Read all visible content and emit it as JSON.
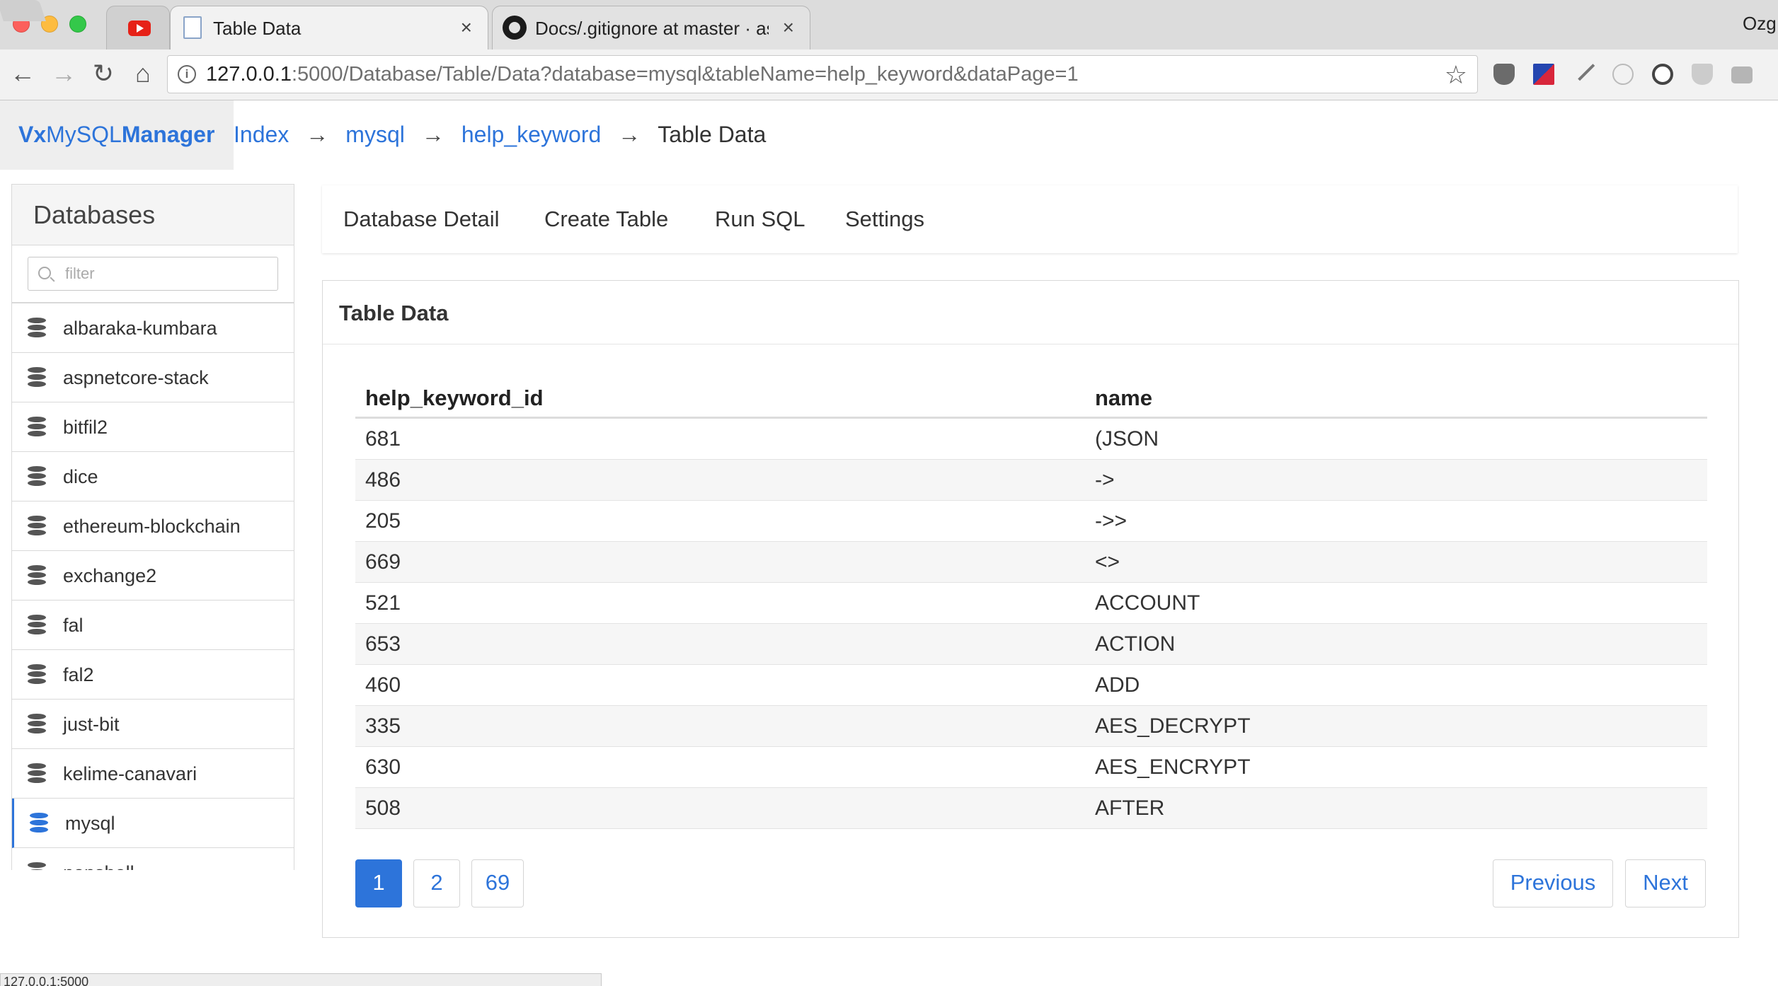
{
  "browser": {
    "tabs": [
      {
        "title": "",
        "icon": "youtube-icon"
      },
      {
        "title": "Table Data",
        "icon": "document-icon",
        "active": true
      },
      {
        "title": "Docs/.gitignore at master · asp",
        "icon": "github-icon"
      }
    ],
    "tab_close_glyph": "×",
    "profile_name": "Ozg",
    "url_host": "127.0.0.1",
    "url_rest": ":5000/Database/Table/Data?database=mysql&tableName=help_keyword&dataPage=1",
    "status_url": "127.0.0.1:5000"
  },
  "app": {
    "brand_prefix": "Vx",
    "brand_middle": "MySQL",
    "brand_suffix": "Manager",
    "accent_color": "#2d74da"
  },
  "breadcrumb": {
    "items": [
      "Index",
      "mysql",
      "help_keyword"
    ],
    "separator": "→",
    "current": "Table Data"
  },
  "sidebar": {
    "title": "Databases",
    "filter_placeholder": "filter",
    "databases": [
      "albaraka-kumbara",
      "aspnetcore-stack",
      "bitfil2",
      "dice",
      "ethereum-blockchain",
      "exchange2",
      "fal",
      "fal2",
      "just-bit",
      "kelime-canavari",
      "mysql",
      "nopshell"
    ],
    "active": "mysql"
  },
  "nav_tabs": [
    "Database Detail",
    "Create Table",
    "Run SQL",
    "Settings"
  ],
  "panel": {
    "title": "Table Data",
    "columns": [
      "help_keyword_id",
      "name"
    ],
    "rows": [
      [
        "681",
        "(JSON"
      ],
      [
        "486",
        "->"
      ],
      [
        "205",
        "->>"
      ],
      [
        "669",
        "<>"
      ],
      [
        "521",
        "ACCOUNT"
      ],
      [
        "653",
        "ACTION"
      ],
      [
        "460",
        "ADD"
      ],
      [
        "335",
        "AES_DECRYPT"
      ],
      [
        "630",
        "AES_ENCRYPT"
      ],
      [
        "508",
        "AFTER"
      ]
    ]
  },
  "pagination": {
    "pages": [
      "1",
      "2",
      "69"
    ],
    "current": "1",
    "previous_label": "Previous",
    "next_label": "Next"
  }
}
